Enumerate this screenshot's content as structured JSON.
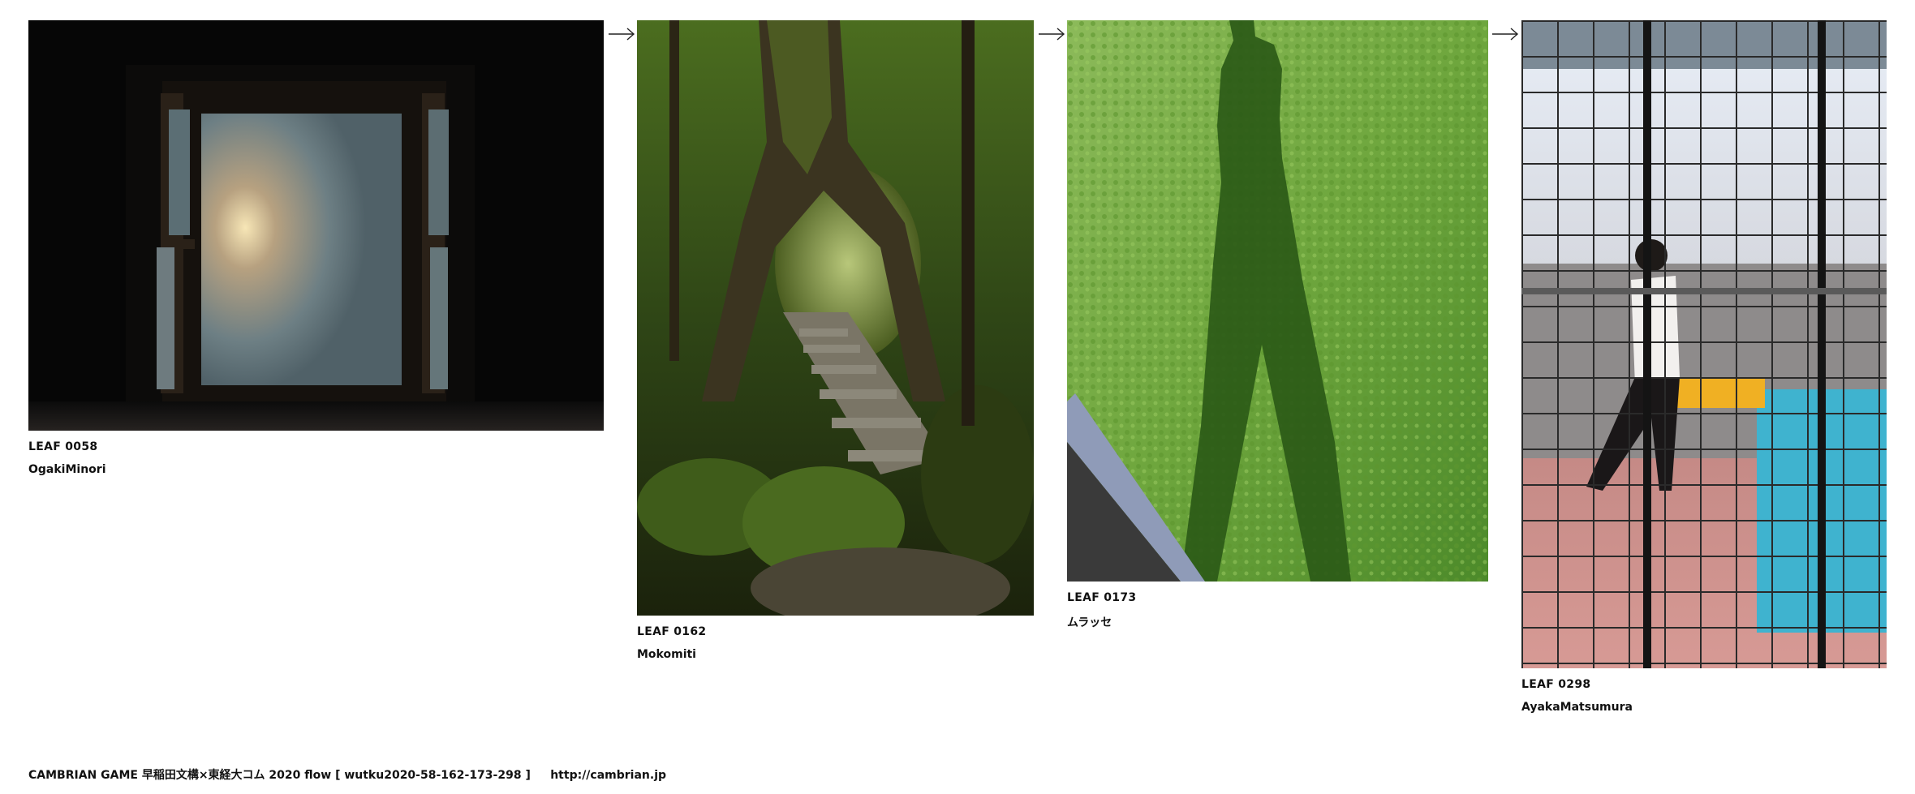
{
  "leaves": [
    {
      "id_label": "LEAF 0058",
      "author": "OgakiMinori",
      "image_desc": "window-photo"
    },
    {
      "id_label": "LEAF 0162",
      "author": "Mokomiti",
      "image_desc": "forest-photo"
    },
    {
      "id_label": "LEAF 0173",
      "author": "ムラッセ",
      "image_desc": "grass-shadow-photo"
    },
    {
      "id_label": "LEAF 0298",
      "author": "AyakaMatsumura",
      "image_desc": "cage-photo"
    }
  ],
  "footer": {
    "text": "CAMBRIAN GAME  早稲田文構×東経大コム 2020  flow [ wutku2020-58-162-173-298 ]",
    "link": "http://cambrian.jp"
  },
  "icons": {
    "arrow": "right-arrow-icon"
  }
}
